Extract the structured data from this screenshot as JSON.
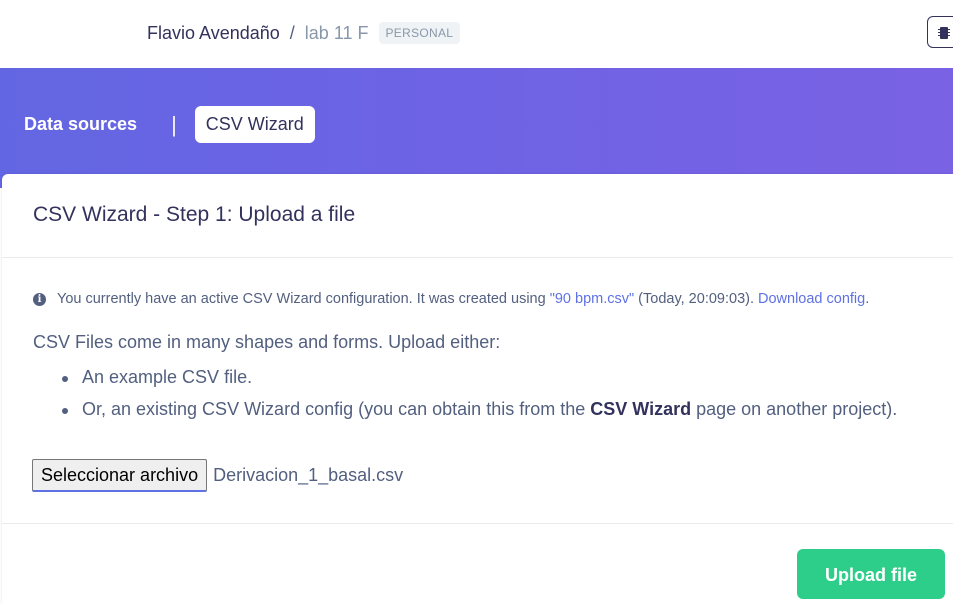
{
  "header": {
    "user": "Flavio Avendaño",
    "separator": "/",
    "project": "lab 11 F",
    "badge": "PERSONAL"
  },
  "nav": {
    "data_sources": "Data sources",
    "divider": "|",
    "csv_wizard": "CSV Wizard"
  },
  "card": {
    "title": "CSV Wizard - Step 1: Upload a file",
    "info": {
      "prefix": "You currently have an active CSV Wizard configuration. It was created using ",
      "file_link": "\"90 bpm.csv\"",
      "middle": " (Today, 20:09:03). ",
      "download_link": "Download config",
      "suffix": "."
    },
    "intro": "CSV Files come in many shapes and forms. Upload either:",
    "bullet1": "An example CSV file.",
    "bullet2_prefix": "Or, an existing CSV Wizard config (you can obtain this from the ",
    "bullet2_bold": "CSV Wizard",
    "bullet2_suffix": " page on another project).",
    "file_button": "Seleccionar archivo",
    "file_name": "Derivacion_1_basal.csv",
    "upload_button": "Upload file"
  },
  "colors": {
    "gradient_start": "#6366e2",
    "gradient_end": "#7a62e4",
    "link": "#5e72e4",
    "upload": "#2dce89"
  }
}
